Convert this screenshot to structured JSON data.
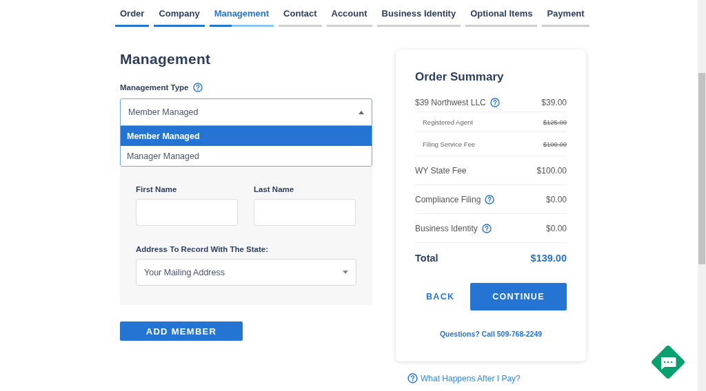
{
  "steps": [
    {
      "label": "Order",
      "completed": true,
      "selected": false
    },
    {
      "label": "Company",
      "completed": true,
      "selected": false
    },
    {
      "label": "Management",
      "completed": false,
      "selected": true,
      "level": 0.35
    },
    {
      "label": "Contact",
      "completed": false,
      "selected": false
    },
    {
      "label": "Account",
      "completed": false,
      "selected": false
    },
    {
      "label": "Business Identity",
      "completed": false,
      "selected": false
    },
    {
      "label": "Optional Items",
      "completed": false,
      "selected": false
    },
    {
      "label": "Payment",
      "completed": false,
      "selected": false
    }
  ],
  "form": {
    "heading": "Management",
    "management_type": {
      "label": "Management Type",
      "value": "Member Managed",
      "expanded": true,
      "options": [
        {
          "label": "Member Managed",
          "selected": true
        },
        {
          "label": "Manager Managed",
          "selected": false
        }
      ]
    },
    "member": {
      "first_name": {
        "label": "First Name"
      },
      "last_name": {
        "label": "Last Name"
      },
      "address": {
        "label": "Address To Record With The State:",
        "value": "Your Mailing Address"
      }
    },
    "add_button": "ADD MEMBER"
  },
  "summary": {
    "title": "Order Summary",
    "lines": [
      {
        "kind": "main",
        "label": "$39 Northwest LLC",
        "help": true,
        "amount": "$39.00"
      },
      {
        "kind": "sub",
        "label": "Registered Agent",
        "help": false,
        "amount": "$125.00"
      },
      {
        "kind": "sub",
        "label": "Filing Service Fee",
        "help": false,
        "amount": "$100.00"
      },
      {
        "kind": "main",
        "label": "WY State Fee",
        "help": false,
        "amount": "$100.00"
      },
      {
        "kind": "main",
        "label": "Compliance Filing",
        "help": true,
        "amount": "$0.00"
      },
      {
        "kind": "main",
        "label": "Business Identity",
        "help": true,
        "amount": "$0.00"
      }
    ],
    "total_label": "Total",
    "total": "$139.00",
    "back": "BACK",
    "continue": "CONTINUE",
    "phone": "Questions? Call 509-768-2249"
  },
  "after_link": "What Happens After I Pay?"
}
